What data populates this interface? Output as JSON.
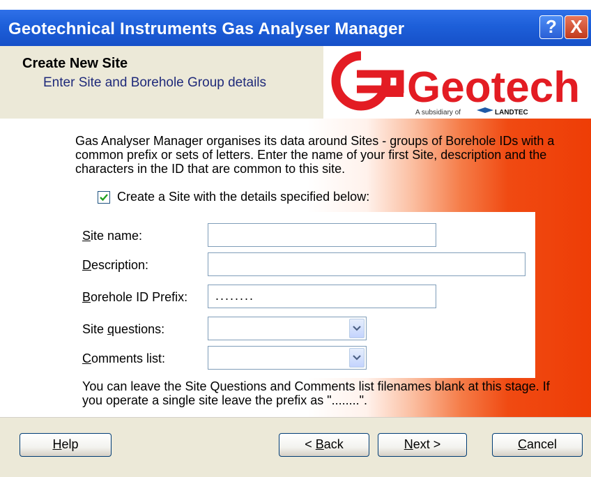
{
  "window": {
    "title": "Geotechnical Instruments Gas Analyser Manager",
    "help_glyph": "?",
    "close_glyph": "X"
  },
  "header": {
    "title": "Create New Site",
    "subtitle": "Enter Site and Borehole Group details",
    "logo_text": "Geotech",
    "logo_tagline": "A subsidiary of",
    "logo_parent": "LANDTEC"
  },
  "content": {
    "intro": "Gas Analyser Manager organises its data around Sites - groups of Borehole IDs with a common prefix or sets of letters. Enter the name of your first Site, description and the characters in the ID that are common to this site.",
    "checkbox_label": "Create a Site with the details specified below:",
    "checkbox_checked": true,
    "note": "You can leave the Site Questions and Comments list filenames blank at this stage. If you operate a single site leave the prefix as \"........\"."
  },
  "form": {
    "site_name": {
      "key": "S",
      "rest": "ite name:",
      "value": ""
    },
    "description": {
      "key": "D",
      "rest": "escription:",
      "value": ""
    },
    "borehole_prefix": {
      "key": "B",
      "rest": "orehole ID Prefix:",
      "value": "........"
    },
    "site_questions": {
      "pre": "Site ",
      "key": "q",
      "rest": "uestions:",
      "value": ""
    },
    "comments_list": {
      "key": "C",
      "rest": "omments list:",
      "value": ""
    }
  },
  "buttons": {
    "help": {
      "key": "H",
      "rest": "elp"
    },
    "back": {
      "pre": "< ",
      "key": "B",
      "rest": "ack"
    },
    "next": {
      "key": "N",
      "rest": "ext >"
    },
    "cancel": {
      "key": "C",
      "rest": "ancel"
    }
  },
  "colors": {
    "titlebar": "#1d5fd9",
    "logo_red": "#e31c23",
    "gradient_end": "#ee3d06",
    "dialog_face": "#ece9d8"
  }
}
